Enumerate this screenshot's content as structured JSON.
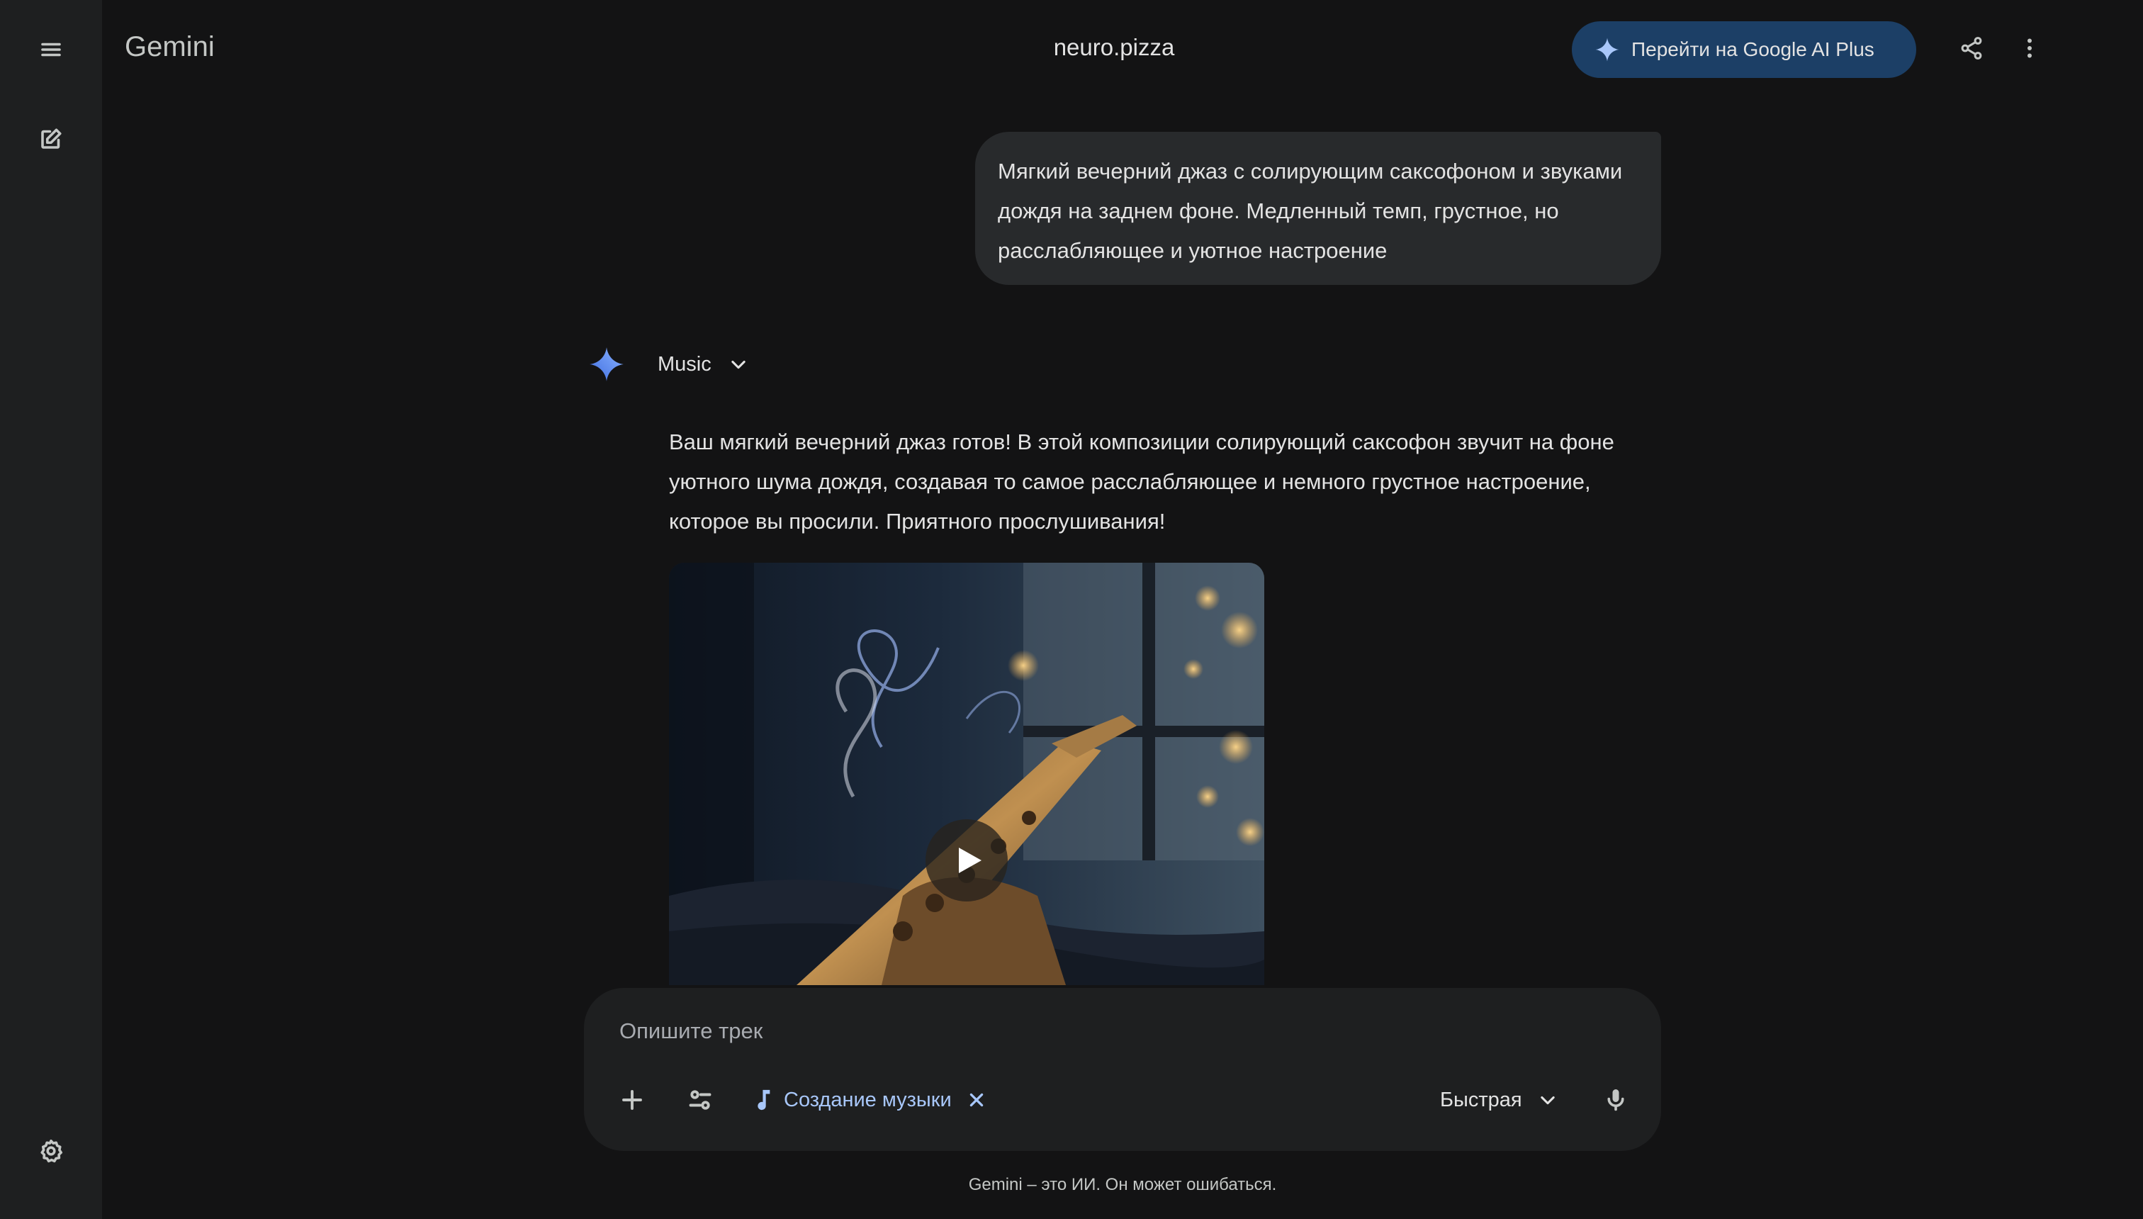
{
  "app": {
    "title": "Gemini",
    "chat_title": "neuro.pizza"
  },
  "header": {
    "upgrade_label": "Перейти на Google AI Plus"
  },
  "sidebar": {
    "icons": [
      "menu-icon",
      "new-chat-icon",
      "settings-icon"
    ]
  },
  "conversation": {
    "user_message": "Мягкий вечерний джаз с солирующим саксофоном и звуками дождя на заднем фоне. Медленный темп, грустное, но расслабляющее и уютное настроение",
    "model_label": "Music",
    "response_text": "Ваш мягкий вечерний джаз готов! В этой композиции солирующий саксофон звучит на фоне уютного шума дождя, создавая то самое расслабляющее и немного грустное настроение, которое вы просили. Приятного прослушивания!",
    "media": {
      "type": "audio-track-cover",
      "icon": "play-icon"
    }
  },
  "composer": {
    "placeholder": "Опишите трек",
    "value": "",
    "tool_chip": "Создание музыки",
    "mode": "Быстрая"
  },
  "footer": {
    "disclaimer": "Gemini – это ИИ. Он может ошибаться."
  },
  "colors": {
    "background": "#131314",
    "sidebar": "#1e1f20",
    "upgrade_button": "#1c3f66",
    "accent_link": "#a8c7fa",
    "user_bubble": "#282a2c"
  }
}
